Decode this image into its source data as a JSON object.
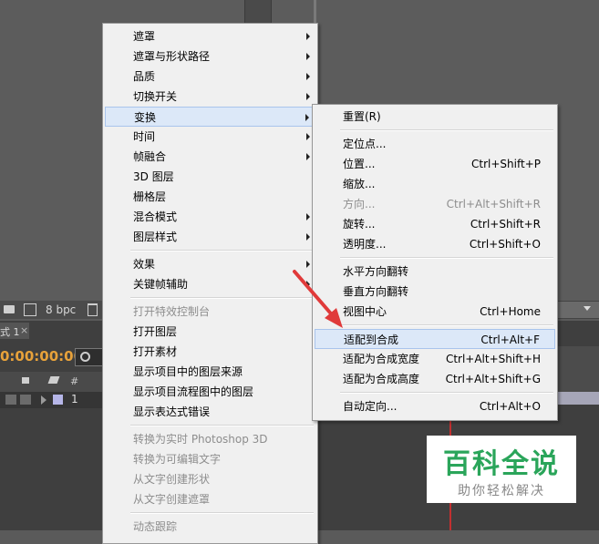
{
  "toolbar": {
    "bpc": "8 bpc"
  },
  "comp": {
    "tab": "式 1",
    "tab_close": "×",
    "timecode": "0:00:00:00",
    "layer_number": "1",
    "col_hash": "#"
  },
  "context_menu": {
    "items": [
      {
        "label": "遮罩",
        "arrow": true
      },
      {
        "label": "遮罩与形状路径",
        "arrow": true
      },
      {
        "label": "品质",
        "arrow": true
      },
      {
        "label": "切换开关",
        "arrow": true
      },
      {
        "label": "变换",
        "arrow": true,
        "highlight": true
      },
      {
        "label": "时间",
        "arrow": true
      },
      {
        "label": "帧融合",
        "arrow": true
      },
      {
        "label": "3D 图层"
      },
      {
        "label": "栅格层"
      },
      {
        "label": "混合模式",
        "arrow": true
      },
      {
        "label": "图层样式",
        "arrow": true
      },
      {
        "sep": true
      },
      {
        "label": "效果",
        "arrow": true
      },
      {
        "label": "关键帧辅助",
        "arrow": true
      },
      {
        "sep": true
      },
      {
        "label": "打开特效控制台",
        "disabled": true
      },
      {
        "label": "打开图层"
      },
      {
        "label": "打开素材"
      },
      {
        "label": "显示项目中的图层来源"
      },
      {
        "label": "显示项目流程图中的图层"
      },
      {
        "label": "显示表达式错误"
      },
      {
        "sep": true
      },
      {
        "label": "转换为实时 Photoshop 3D",
        "disabled": true
      },
      {
        "label": "转换为可编辑文字",
        "disabled": true
      },
      {
        "label": "从文字创建形状",
        "disabled": true
      },
      {
        "label": "从文字创建遮罩",
        "disabled": true
      },
      {
        "sep": true
      },
      {
        "label": "动态跟踪",
        "disabled": true
      }
    ]
  },
  "submenu": {
    "items": [
      {
        "label": "重置(R)"
      },
      {
        "sep": true
      },
      {
        "label": "定位点..."
      },
      {
        "label": "位置...",
        "shortcut": "Ctrl+Shift+P"
      },
      {
        "label": "缩放..."
      },
      {
        "label": "方向...",
        "shortcut": "Ctrl+Alt+Shift+R",
        "disabled": true
      },
      {
        "label": "旋转...",
        "shortcut": "Ctrl+Shift+R"
      },
      {
        "label": "透明度...",
        "shortcut": "Ctrl+Shift+O"
      },
      {
        "sep": true
      },
      {
        "label": "水平方向翻转"
      },
      {
        "label": "垂直方向翻转"
      },
      {
        "label": "视图中心",
        "shortcut": "Ctrl+Home"
      },
      {
        "sep": true
      },
      {
        "label": "适配到合成",
        "shortcut": "Ctrl+Alt+F",
        "highlight": true
      },
      {
        "label": "适配为合成宽度",
        "shortcut": "Ctrl+Alt+Shift+H"
      },
      {
        "label": "适配为合成高度",
        "shortcut": "Ctrl+Alt+Shift+G"
      },
      {
        "sep": true
      },
      {
        "label": "自动定向...",
        "shortcut": "Ctrl+Alt+O"
      }
    ]
  },
  "watermark": {
    "title": "百科全说",
    "subtitle": "助你轻松解决"
  },
  "colors": {
    "highlight": "#dce8f8",
    "arrow": "#e03a3a",
    "timecode": "#e8a23a",
    "watermark": "#2aa55a"
  }
}
